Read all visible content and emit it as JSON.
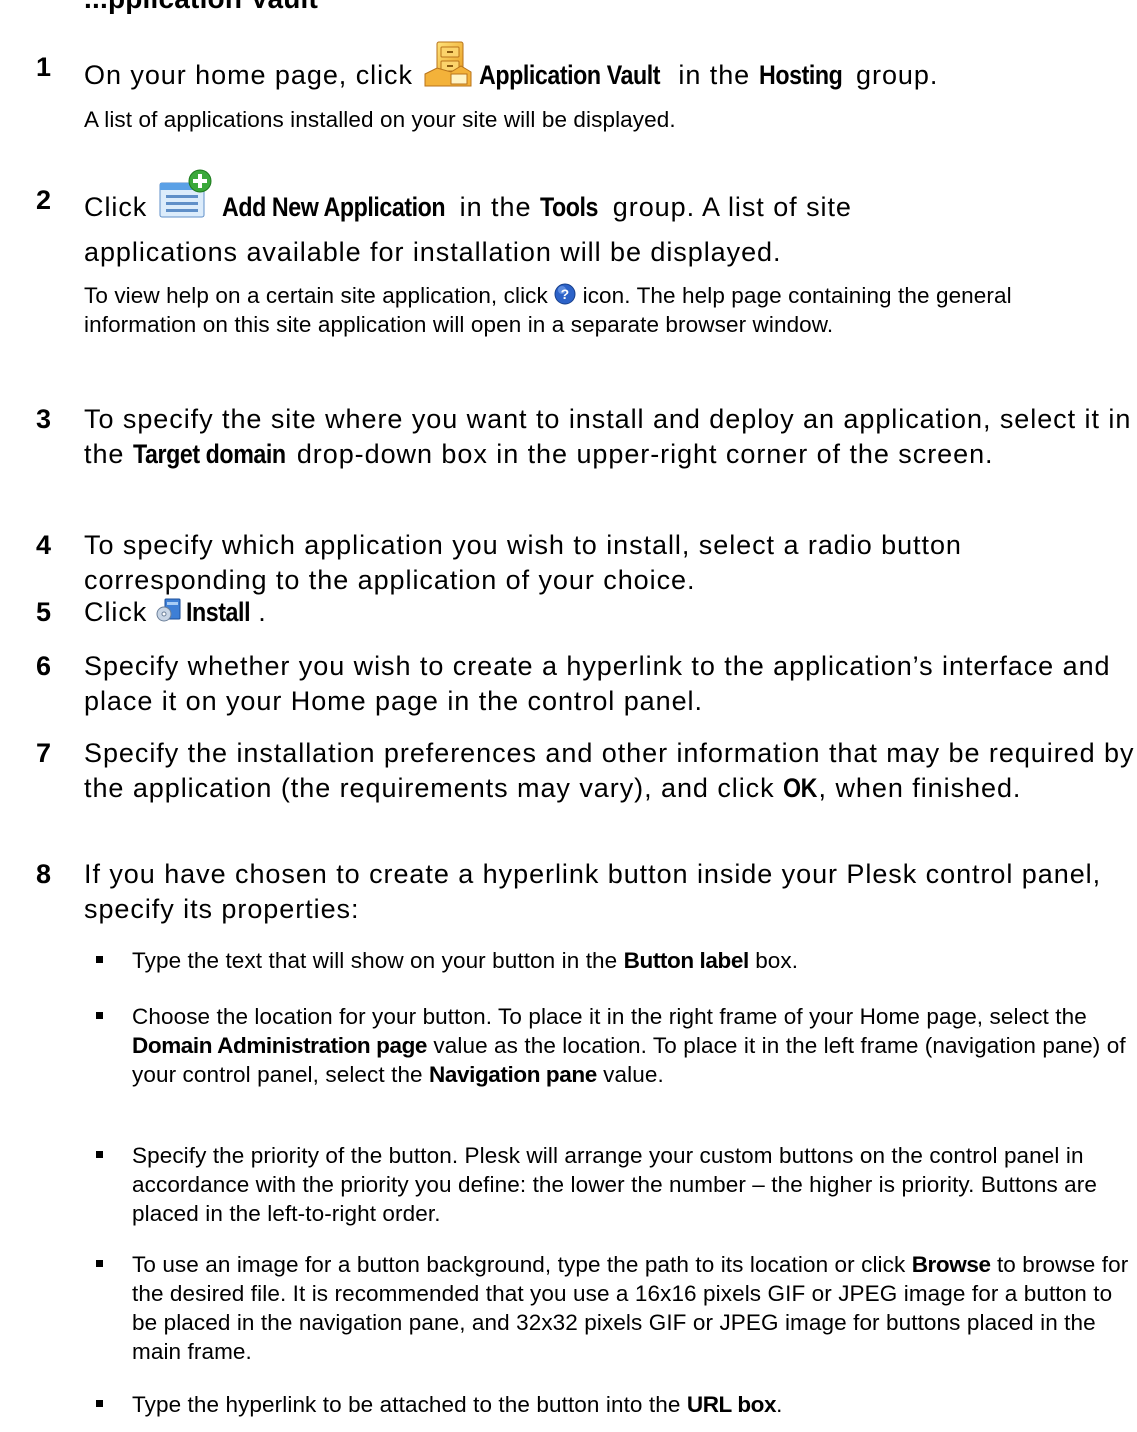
{
  "heading_fragment": "...pplication Vault",
  "steps": [
    {
      "num": "1",
      "parts": {
        "pre": "On your home page, click ",
        "icon_name": "application-vault-icon",
        "b1": "Application Vault",
        "mid": " in the ",
        "b2": "Hosting",
        "post": " group."
      },
      "note": "A list of applications installed on your site will be displayed."
    },
    {
      "num": "2",
      "parts": {
        "pre": "Click ",
        "icon_name": "add-new-application-icon",
        "b1": "Add New Application",
        "mid": " in the ",
        "b2": "Tools",
        "post": " group. A list of site",
        "line2": "applications available for installation will be displayed."
      },
      "note_parts": {
        "pre": "To view help on a certain site application, click ",
        "icon_name": "help-icon",
        "post": " icon. The help page containing the general information on this site application will open in a separate browser window."
      }
    },
    {
      "num": "3",
      "parts": {
        "pre": "To specify the site where you want to install and deploy an application, select it in the ",
        "b1": "Target domain",
        "post": " drop-down box in the upper-right corner of the screen."
      }
    },
    {
      "num": "4",
      "text": "To specify which application you wish to install, select a radio button corresponding to the application of your choice."
    },
    {
      "num": "5",
      "parts": {
        "pre": "Click ",
        "icon_name": "install-icon",
        "b1": "Install",
        "post": "."
      }
    },
    {
      "num": "6",
      "text": "Specify whether you wish to create a hyperlink to the application’s interface and place it on your Home page in the control panel."
    },
    {
      "num": "7",
      "parts": {
        "pre": "Specify the installation preferences and other information that may be required by the application (the requirements may vary), and click ",
        "b1": "OK",
        "post": ", when finished."
      }
    },
    {
      "num": "8",
      "text": "If you have chosen to create a hyperlink button inside your Plesk control panel, specify its properties:"
    }
  ],
  "bullets": [
    {
      "pre": "Type the text that will show on your button in the ",
      "b1": "Button label",
      "post": " box."
    },
    {
      "pre": "Choose the location for your button. To place it in the right frame of your Home page, select the ",
      "b1": "Domain Administration page",
      "mid": " value as the location. To place it in the left frame (navigation pane) of your control panel, select the ",
      "b2": "Navigation pane",
      "post": " value."
    },
    {
      "text": "Specify the priority of the button. Plesk will arrange your custom buttons on the control panel in accordance with the priority you define: the lower the number – the higher is priority. Buttons are placed in the left-to-right order."
    },
    {
      "pre": "To use an image for a button background, type the path to its location or click ",
      "b1": "Browse",
      "post": " to browse for the desired file. It is recommended that you use a 16x16 pixels GIF or JPEG image for a button to be placed in the navigation pane, and 32x32 pixels GIF or JPEG image for buttons placed in the main frame."
    },
    {
      "pre": "Type the hyperlink to be attached to the button into the ",
      "b1": "URL box",
      "post": "."
    }
  ]
}
